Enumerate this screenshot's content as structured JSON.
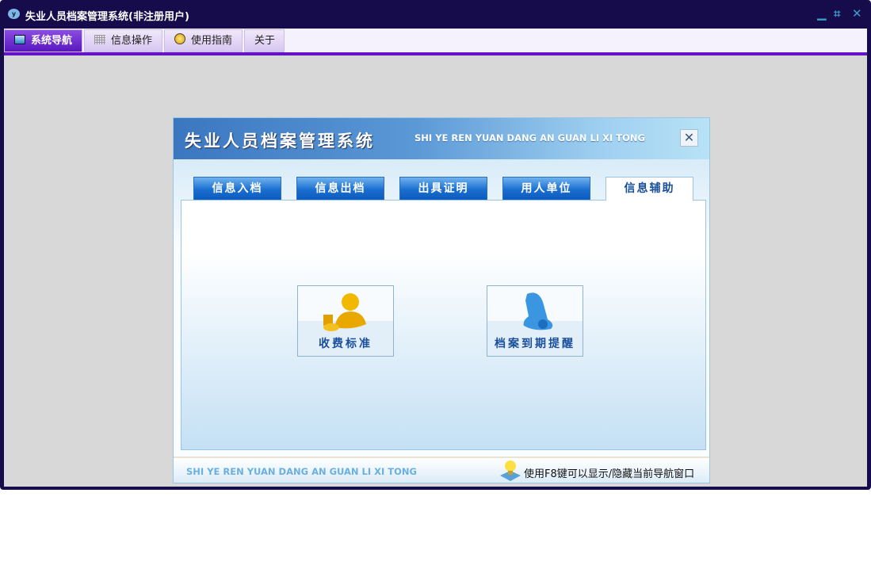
{
  "window": {
    "title": "失业人员档案管理系统(非注册用户)",
    "app_icon": "y"
  },
  "menu": [
    {
      "label": "系统导航",
      "icon": "monitor-icon"
    },
    {
      "label": "信息操作",
      "icon": "grid-icon"
    },
    {
      "label": "使用指南",
      "icon": "help-icon"
    },
    {
      "label": "关于"
    }
  ],
  "dialog": {
    "title": "失业人员档案管理系统",
    "subtitle": "SHI YE REN YUAN DANG AN GUAN LI XI TONG",
    "close": "✕",
    "tabs": [
      "信息入档",
      "信息出档",
      "出具证明",
      "用人单位",
      "信息辅助"
    ],
    "active_tab": 4,
    "buttons": [
      {
        "label": "收费标准",
        "icon": "coins-user-icon"
      },
      {
        "label": "档案到期提醒",
        "icon": "bell-icon"
      }
    ],
    "footer": {
      "subtitle": "SHI YE REN YUAN DANG AN GUAN LI XI TONG",
      "hint": "使用F8键可以显示/隐藏当前导航窗口"
    }
  }
}
